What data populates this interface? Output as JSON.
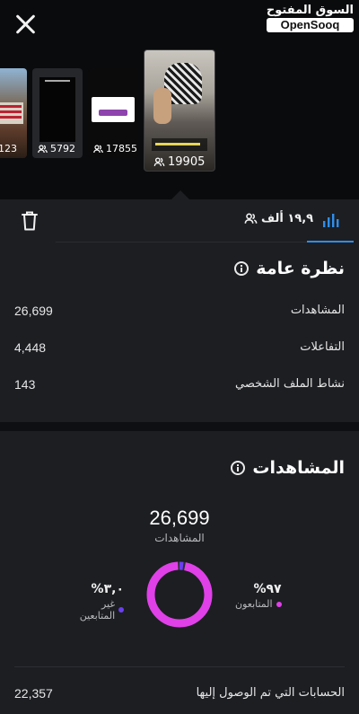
{
  "watermark": {
    "arabic": "السوق المفتوح",
    "brand": "OpenSooq"
  },
  "stories": [
    {
      "count": "123"
    },
    {
      "count": "5792"
    },
    {
      "count": "17855"
    },
    {
      "count": "19905"
    }
  ],
  "tabs": {
    "followers_label": "١٩,٩ ألف"
  },
  "overview": {
    "title": "نظرة عامة",
    "rows": [
      {
        "label": "المشاهدات",
        "value": "26,699"
      },
      {
        "label": "التفاعلات",
        "value": "4,448"
      },
      {
        "label": "نشاط الملف الشخصي",
        "value": "143"
      }
    ]
  },
  "views": {
    "title": "المشاهدات",
    "total": "26,699",
    "total_label": "المشاهدات",
    "followers": {
      "pct": "٩٧%",
      "label": "المتابعون",
      "fraction": 0.97,
      "color": "#e040e8"
    },
    "non_followers": {
      "pct": "٣,٠%",
      "label": "غير المتابعين",
      "fraction": 0.03,
      "color": "#6b3ff0"
    },
    "accounts_reached_label": "الحسابات التي تم الوصول إليها",
    "accounts_reached_value": "22,357"
  }
}
